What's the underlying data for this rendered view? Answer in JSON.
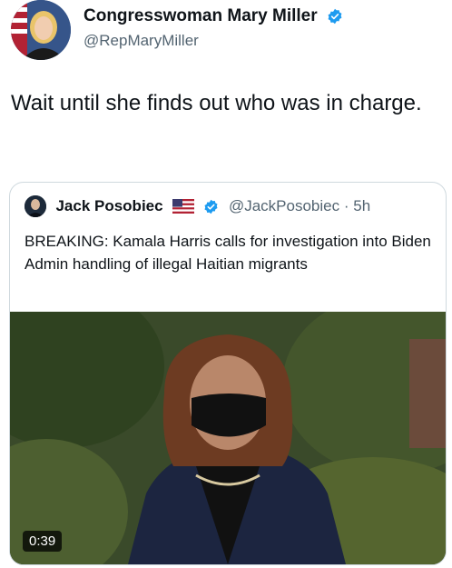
{
  "tweet": {
    "author_name": "Congresswoman Mary Miller",
    "author_handle": "@RepMaryMiller",
    "text": "Wait until she finds out who was in charge."
  },
  "quoted_tweet": {
    "author_name": "Jack Posobiec",
    "author_handle": "@JackPosobiec",
    "separator": "·",
    "time_ago": "5h",
    "text": "BREAKING: Kamala Harris calls for investigation into Biden Admin handling of illegal Haitian migrants",
    "video_duration": "0:39"
  },
  "colors": {
    "verified_blue": "#1d9bf0",
    "text_primary": "#0f1419",
    "text_secondary": "#536471",
    "border": "#cfd9de"
  },
  "icons": {
    "verified": "verified-badge-icon",
    "flag": "us-flag-icon",
    "play_duration": "video-duration-badge"
  }
}
